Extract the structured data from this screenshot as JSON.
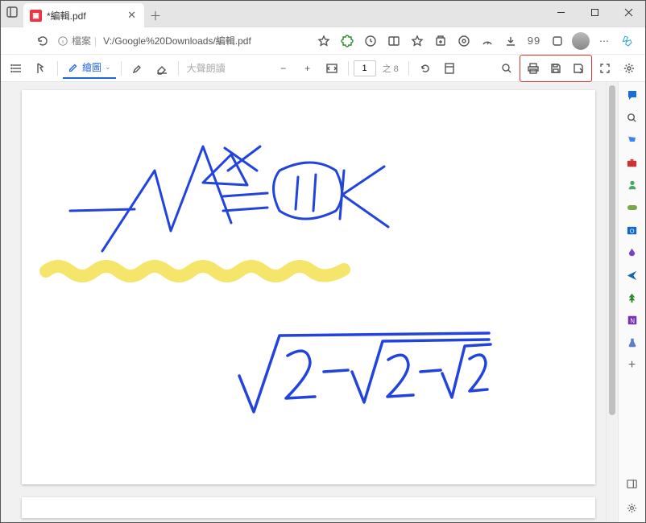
{
  "window": {
    "tab_title": "*編輯.pdf"
  },
  "address": {
    "protocol_label": "檔案",
    "url": "V:/Google%20Downloads/編輯.pdf",
    "quote_marks": "99"
  },
  "pdf_toolbar": {
    "draw_label": "繪圖",
    "read_aloud_label": "大聲朗讀",
    "page_value": "1",
    "total_pages_label": "之 8"
  },
  "icons": {
    "minus": "−",
    "plus": "+"
  }
}
